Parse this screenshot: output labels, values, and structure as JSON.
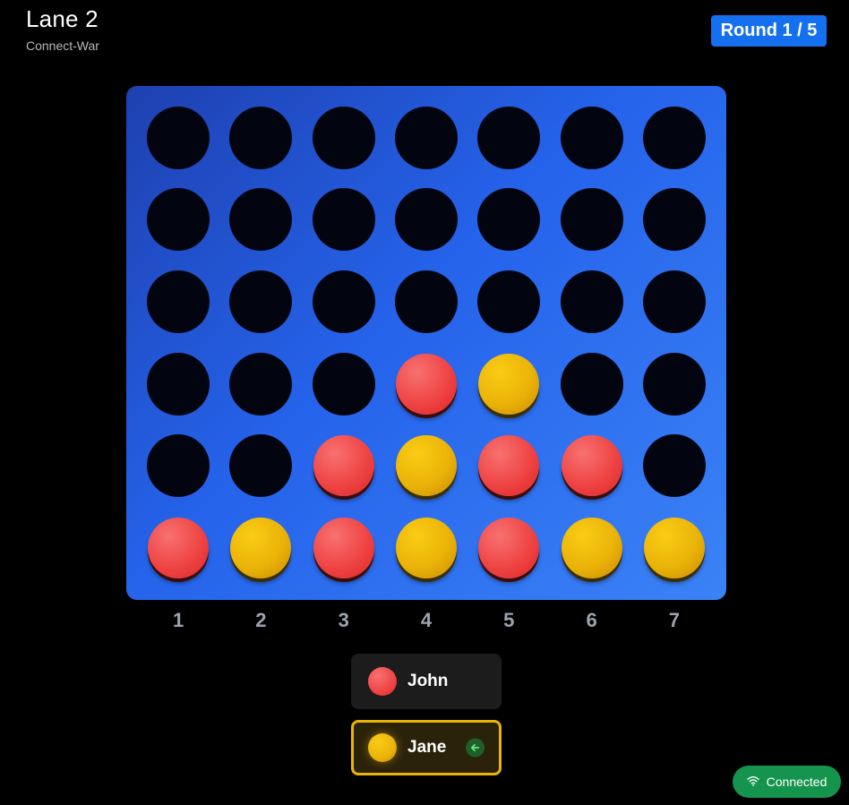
{
  "header": {
    "title": "Lane 2",
    "subtitle": "Connect-War",
    "round_label": "Round 1 / 5"
  },
  "board": {
    "rows": 6,
    "columns": 7,
    "grid": [
      [
        "empty",
        "empty",
        "empty",
        "empty",
        "empty",
        "empty",
        "empty"
      ],
      [
        "empty",
        "empty",
        "empty",
        "empty",
        "empty",
        "empty",
        "empty"
      ],
      [
        "empty",
        "empty",
        "empty",
        "empty",
        "empty",
        "empty",
        "empty"
      ],
      [
        "empty",
        "empty",
        "empty",
        "red",
        "yellow",
        "empty",
        "empty"
      ],
      [
        "empty",
        "empty",
        "red",
        "yellow",
        "red",
        "red",
        "empty"
      ],
      [
        "red",
        "yellow",
        "red",
        "yellow",
        "red",
        "yellow",
        "yellow"
      ]
    ],
    "column_labels": [
      "1",
      "2",
      "3",
      "4",
      "5",
      "6",
      "7"
    ],
    "colors": {
      "red": "#ef4444",
      "yellow": "#eab308",
      "board": "#2563eb",
      "hole": "#02050f"
    }
  },
  "players": [
    {
      "name": "John",
      "color": "red",
      "active": false
    },
    {
      "name": "Jane",
      "color": "yellow",
      "active": true,
      "turn_icon": "arrow-left-icon"
    }
  ],
  "status": {
    "label": "Connected",
    "icon": "wifi-icon",
    "color": "#15944d"
  }
}
